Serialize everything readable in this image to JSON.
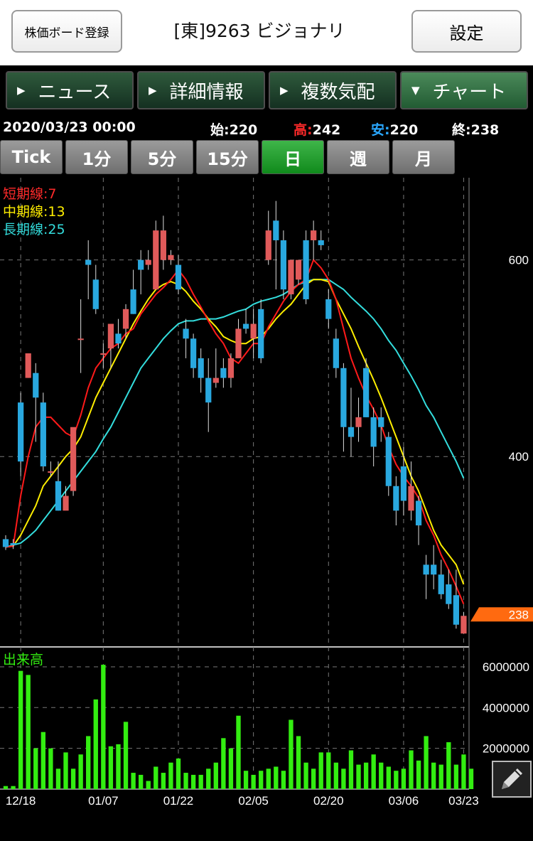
{
  "header": {
    "board_button": "株価ボード登録",
    "title": "[東]9263 ビジョナリ",
    "settings_button": "設定"
  },
  "tabs": [
    {
      "label": "ニュース",
      "active": false
    },
    {
      "label": "詳細情報",
      "active": false
    },
    {
      "label": "複数気配",
      "active": false
    },
    {
      "label": "チャート",
      "active": true
    }
  ],
  "quote": {
    "datetime": "2020/03/23 00:00",
    "open_label": "始:",
    "open": "220",
    "high_label": "高:",
    "high": "242",
    "low_label": "安:",
    "low": "220",
    "close_label": "終:",
    "close": "238"
  },
  "periods": [
    {
      "label": "Tick",
      "active": false
    },
    {
      "label": "1分",
      "active": false
    },
    {
      "label": "5分",
      "active": false
    },
    {
      "label": "15分",
      "active": false
    },
    {
      "label": "日",
      "active": true
    },
    {
      "label": "週",
      "active": false
    },
    {
      "label": "月",
      "active": false
    }
  ],
  "legend": {
    "short": "短期線:7",
    "mid": "中期線:13",
    "long": "長期線:25",
    "volume": "出来高"
  },
  "colors": {
    "up": "#e05a5a",
    "down": "#29a8df",
    "short_ma": "#ff1a1a",
    "mid_ma": "#ffee00",
    "long_ma": "#33dddd",
    "volume": "#33ee11",
    "price_tag": "#ff6a10"
  },
  "icons": {
    "edit": "pencil-icon"
  },
  "chart_data": {
    "type": "candlestick",
    "x_ticks": [
      "12/18",
      "01/07",
      "01/22",
      "02/05",
      "02/20",
      "03/06",
      "03/23"
    ],
    "price_ticks": [
      600,
      400
    ],
    "price_range": [
      210,
      680
    ],
    "last_price": 238,
    "volume_ticks": [
      6000000,
      4000000,
      2000000
    ],
    "volume_range": [
      0,
      6800000
    ],
    "candles": [
      {
        "o": 316,
        "h": 320,
        "c": 308,
        "l": 305
      },
      {
        "o": 312,
        "h": 316,
        "c": 310,
        "l": 306
      },
      {
        "o": 455,
        "h": 465,
        "c": 395,
        "l": 380
      },
      {
        "o": 480,
        "h": 505,
        "c": 505,
        "l": 480
      },
      {
        "o": 485,
        "h": 495,
        "c": 460,
        "l": 415
      },
      {
        "o": 455,
        "h": 465,
        "c": 390,
        "l": 385
      },
      {
        "o": 385,
        "h": 395,
        "c": 385,
        "l": 380
      },
      {
        "o": 375,
        "h": 395,
        "c": 345,
        "l": 345
      },
      {
        "o": 345,
        "h": 370,
        "c": 360,
        "l": 350
      },
      {
        "o": 365,
        "h": 395,
        "c": 430,
        "l": 360
      },
      {
        "o": 520,
        "h": 560,
        "c": 520,
        "l": 485
      },
      {
        "o": 600,
        "h": 620,
        "c": 595,
        "l": 560
      },
      {
        "o": 580,
        "h": 595,
        "c": 550,
        "l": 545
      },
      {
        "o": 505,
        "h": 515,
        "c": 505,
        "l": 490
      },
      {
        "o": 510,
        "h": 530,
        "c": 535,
        "l": 490
      },
      {
        "o": 525,
        "h": 540,
        "c": 515,
        "l": 510
      },
      {
        "o": 530,
        "h": 555,
        "c": 550,
        "l": 520
      },
      {
        "o": 570,
        "h": 590,
        "c": 545,
        "l": 545
      },
      {
        "o": 600,
        "h": 610,
        "c": 590,
        "l": 565
      },
      {
        "o": 595,
        "h": 610,
        "c": 600,
        "l": 590
      },
      {
        "o": 570,
        "h": 640,
        "c": 630,
        "l": 570
      },
      {
        "o": 600,
        "h": 645,
        "c": 630,
        "l": 590
      },
      {
        "o": 600,
        "h": 610,
        "c": 605,
        "l": 595
      },
      {
        "o": 595,
        "h": 605,
        "c": 570,
        "l": 565
      },
      {
        "o": 530,
        "h": 540,
        "c": 520,
        "l": 500
      },
      {
        "o": 520,
        "h": 525,
        "c": 490,
        "l": 480
      },
      {
        "o": 500,
        "h": 510,
        "c": 480,
        "l": 465
      },
      {
        "o": 480,
        "h": 500,
        "c": 455,
        "l": 425
      },
      {
        "o": 475,
        "h": 510,
        "c": 480,
        "l": 470
      },
      {
        "o": 490,
        "h": 500,
        "c": 480,
        "l": 470
      },
      {
        "o": 480,
        "h": 505,
        "c": 500,
        "l": 470
      },
      {
        "o": 500,
        "h": 540,
        "c": 530,
        "l": 525
      },
      {
        "o": 535,
        "h": 550,
        "c": 530,
        "l": 525
      },
      {
        "o": 520,
        "h": 550,
        "c": 535,
        "l": 500
      },
      {
        "o": 550,
        "h": 560,
        "c": 500,
        "l": 495
      },
      {
        "o": 600,
        "h": 650,
        "c": 630,
        "l": 595
      },
      {
        "o": 640,
        "h": 660,
        "c": 620,
        "l": 570
      },
      {
        "o": 620,
        "h": 630,
        "c": 570,
        "l": 560
      },
      {
        "o": 565,
        "h": 590,
        "c": 600,
        "l": 560
      },
      {
        "o": 580,
        "h": 600,
        "c": 600,
        "l": 575
      },
      {
        "o": 620,
        "h": 630,
        "c": 560,
        "l": 555
      },
      {
        "o": 620,
        "h": 640,
        "c": 630,
        "l": 600
      },
      {
        "o": 620,
        "h": 630,
        "c": 615,
        "l": 610
      },
      {
        "o": 560,
        "h": 570,
        "c": 540,
        "l": 530
      },
      {
        "o": 520,
        "h": 530,
        "c": 490,
        "l": 480
      },
      {
        "o": 490,
        "h": 495,
        "c": 430,
        "l": 405
      },
      {
        "o": 430,
        "h": 470,
        "c": 420,
        "l": 400
      },
      {
        "o": 430,
        "h": 460,
        "c": 440,
        "l": 415
      },
      {
        "o": 490,
        "h": 500,
        "c": 440,
        "l": 440
      },
      {
        "o": 440,
        "h": 450,
        "c": 410,
        "l": 390
      },
      {
        "o": 440,
        "h": 450,
        "c": 430,
        "l": 415
      },
      {
        "o": 420,
        "h": 425,
        "c": 370,
        "l": 360
      },
      {
        "o": 370,
        "h": 380,
        "c": 345,
        "l": 330
      },
      {
        "o": 390,
        "h": 410,
        "c": 355,
        "l": 340
      },
      {
        "o": 345,
        "h": 395,
        "c": 370,
        "l": 335
      },
      {
        "o": 355,
        "h": 360,
        "c": 330,
        "l": 310
      },
      {
        "o": 290,
        "h": 300,
        "c": 280,
        "l": 255
      },
      {
        "o": 290,
        "h": 310,
        "c": 280,
        "l": 265
      },
      {
        "o": 280,
        "h": 295,
        "c": 260,
        "l": 255
      },
      {
        "o": 270,
        "h": 285,
        "c": 250,
        "l": 245
      },
      {
        "o": 259,
        "h": 285,
        "c": 229,
        "l": 225
      },
      {
        "o": 220,
        "h": 242,
        "c": 238,
        "l": 220
      }
    ],
    "ma_short": [
      308,
      309,
      360,
      400,
      430,
      440,
      440,
      432,
      424,
      420,
      442,
      470,
      490,
      500,
      510,
      515,
      525,
      530,
      545,
      555,
      565,
      572,
      580,
      590,
      580,
      565,
      552,
      538,
      525,
      515,
      500,
      495,
      505,
      515,
      515,
      532,
      545,
      558,
      568,
      575,
      580,
      600,
      592,
      580,
      560,
      530,
      500,
      480,
      462,
      448,
      432,
      410,
      392,
      380,
      370,
      358,
      335,
      320,
      300,
      285,
      268,
      250
    ],
    "ma_short_visible": true,
    "ma_mid": [
      308,
      309,
      320,
      335,
      350,
      370,
      380,
      390,
      400,
      408,
      420,
      440,
      460,
      475,
      490,
      505,
      520,
      535,
      548,
      560,
      570,
      575,
      578,
      575,
      568,
      558,
      550,
      540,
      532,
      522,
      518,
      515,
      515,
      520,
      522,
      530,
      540,
      548,
      555,
      565,
      575,
      580,
      580,
      578,
      560,
      545,
      530,
      512,
      495,
      478,
      460,
      440,
      420,
      400,
      380,
      365,
      345,
      325,
      310,
      300,
      290,
      270
    ],
    "ma_long": [
      308,
      310,
      312,
      318,
      325,
      335,
      345,
      355,
      365,
      375,
      385,
      395,
      405,
      418,
      430,
      445,
      460,
      475,
      490,
      500,
      510,
      520,
      528,
      535,
      538,
      538,
      540,
      540,
      540,
      542,
      545,
      548,
      550,
      555,
      558,
      560,
      562,
      565,
      570,
      575,
      578,
      580,
      580,
      580,
      575,
      570,
      562,
      555,
      548,
      540,
      530,
      518,
      508,
      495,
      482,
      468,
      452,
      440,
      425,
      410,
      395,
      378
    ],
    "volume": [
      150000,
      150000,
      5800000,
      5600000,
      2000000,
      2800000,
      2000000,
      1000000,
      1800000,
      1000000,
      1700000,
      2600000,
      4400000,
      6100000,
      2100000,
      2200000,
      3300000,
      800000,
      700000,
      400000,
      1100000,
      800000,
      1300000,
      1500000,
      800000,
      700000,
      700000,
      1000000,
      1300000,
      2500000,
      2000000,
      3600000,
      900000,
      700000,
      900000,
      1000000,
      1100000,
      900000,
      3400000,
      2600000,
      1300000,
      1000000,
      1800000,
      1800000,
      1300000,
      1000000,
      1900000,
      1200000,
      1300000,
      1700000,
      1300000,
      1100000,
      900000,
      1000000,
      1900000,
      1400000,
      2600000,
      1300000,
      1200000,
      2300000,
      1200000,
      1700000,
      1000000
    ]
  }
}
